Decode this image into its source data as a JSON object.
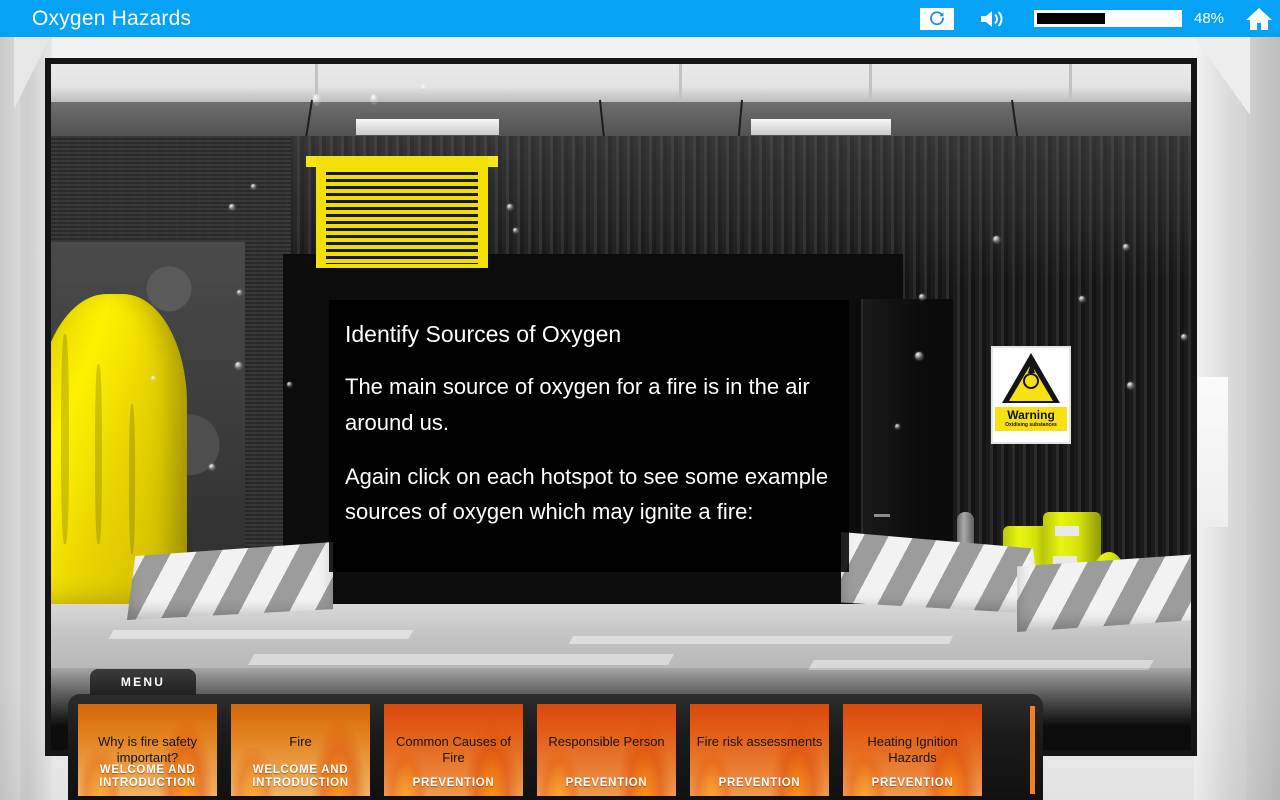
{
  "topbar": {
    "title": "Oxygen Hazards",
    "replay_icon": "replay-icon",
    "volume_icon": "speaker-icon",
    "progress_percent_label": "48%",
    "progress_value": 48,
    "home_icon": "home-icon",
    "background_color": "#06a2f5"
  },
  "slide": {
    "heading": "Identify Sources of Oxygen",
    "paragraph_1": "The main source of oxygen for a fire is in the air around us.",
    "paragraph_2": "Again click on each hotspot to see some example sources of oxygen which may ignite a fire:",
    "warning_sign": {
      "title": "Warning",
      "subtitle": "Oxidising substances"
    }
  },
  "menu": {
    "tab_label": "MENU",
    "items": [
      {
        "title": "Why is fire safety important?",
        "category": "WELCOME AND INTRODUCTION",
        "hot": false
      },
      {
        "title": "Fire",
        "category": "WELCOME AND INTRODUCTION",
        "hot": false
      },
      {
        "title": "Common Causes of Fire",
        "category": "PREVENTION",
        "hot": true
      },
      {
        "title": "Responsible Person",
        "category": "PREVENTION",
        "hot": true
      },
      {
        "title": "Fire risk assessments",
        "category": "PREVENTION",
        "hot": true
      },
      {
        "title": "Heating Ignition Hazards",
        "category": "PREVENTION",
        "hot": true
      }
    ]
  }
}
